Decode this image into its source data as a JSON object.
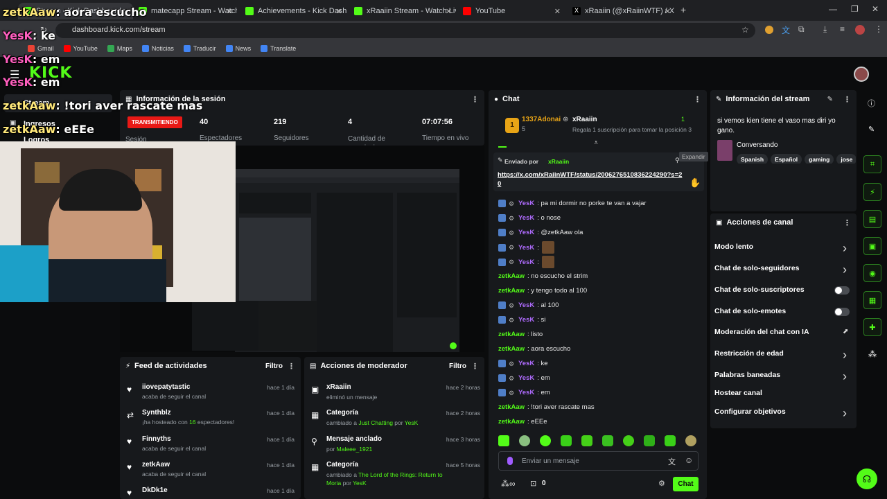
{
  "browser": {
    "tabs": [
      {
        "label": "Stream - Kick Dashboard",
        "color": "#53fc18"
      },
      {
        "label": "matecapp Stream - Watch Live",
        "color": "#53fc18"
      },
      {
        "label": "Achievements - Kick Dashboard",
        "color": "#53fc18"
      },
      {
        "label": "xRaaiin Stream - Watch Live on",
        "color": "#53fc18"
      },
      {
        "label": "YouTube",
        "color": "#ff0000"
      },
      {
        "label": "xRaaiin (@xRaiinWTF) / X",
        "color": "#111111"
      }
    ],
    "url": "dashboard.kick.com/stream",
    "bookmarks": [
      "Gmail",
      "YouTube",
      "Maps",
      "Noticias",
      "Traducir",
      "News",
      "Translate"
    ]
  },
  "overlay_chat": [
    {
      "user": "zetkAaw",
      "text": ": aora escucho",
      "style": "n1"
    },
    {
      "user": "YesK",
      "text": ": ke",
      "style": "n2"
    },
    {
      "user": "YesK",
      "text": ": em",
      "style": "n2"
    },
    {
      "user": "YesK",
      "text": ": em",
      "style": "n2"
    },
    {
      "user": "zetkAaw",
      "text": ": !tori aver rascate mas",
      "style": "n1"
    },
    {
      "user": "zetkAaw",
      "text": ": eEEe",
      "style": "n1"
    }
  ],
  "leftnav": {
    "stream": "Stream",
    "ingresos": "Ingresos",
    "logros": "Logros"
  },
  "session": {
    "title": "Información de la sesión",
    "live_badge": "TRANSMITIENDO",
    "session_label": "Sesión",
    "stats": [
      {
        "value": "40",
        "label": "Espectadores"
      },
      {
        "value": "219",
        "label": "Seguidores"
      },
      {
        "value": "4",
        "label": "Cantidad de suscripciones"
      },
      {
        "value": "07:07:56",
        "label": "Tiempo en vivo"
      }
    ]
  },
  "activity": {
    "title": "Feed de actividades",
    "filter": "Filtro",
    "items": [
      {
        "name": "iiovepatytastic",
        "sub_pre": "acaba de seguir el canal",
        "sub_hl": "",
        "sub_post": "",
        "time": "hace 1 día",
        "icon": "heart-icon"
      },
      {
        "name": "Synthblz",
        "sub_pre": "¡ha hosteado con ",
        "sub_hl": "16",
        "sub_post": " espectadores!",
        "time": "hace 1 día",
        "icon": "host-icon"
      },
      {
        "name": "Finnyths",
        "sub_pre": "acaba de seguir el canal",
        "sub_hl": "",
        "sub_post": "",
        "time": "hace 1 día",
        "icon": "heart-icon"
      },
      {
        "name": "zetkAaw",
        "sub_pre": "acaba de seguir el canal",
        "sub_hl": "",
        "sub_post": "",
        "time": "hace 1 día",
        "icon": "heart-icon"
      },
      {
        "name": "DkDk1e",
        "sub_pre": "",
        "sub_hl": "",
        "sub_post": "",
        "time": "hace 1 día",
        "icon": "heart-icon"
      }
    ]
  },
  "modactions": {
    "title": "Acciones de moderador",
    "filter": "Filtro",
    "items": [
      {
        "name": "xRaaiin",
        "sub_pre": "eliminó un mensaje",
        "hl1": "",
        "mid": "",
        "hl2": "",
        "time": "hace 2 horas"
      },
      {
        "name": "Categoría",
        "sub_pre": "cambiado a ",
        "hl1": "Just Chatting",
        "mid": " por ",
        "hl2": "YesK",
        "time": "hace 2 horas"
      },
      {
        "name": "Mensaje anclado",
        "sub_pre": "por ",
        "hl1": "Maleee_1921",
        "mid": "",
        "hl2": "",
        "time": "hace 3 horas"
      },
      {
        "name": "Categoría",
        "sub_pre": "cambiado a ",
        "hl1": "The Lord of the Rings: Return to Moria",
        "mid": " por ",
        "hl2": "YesK",
        "time": "hace 5 horas"
      }
    ]
  },
  "chat": {
    "title": "Chat",
    "top_user": "1337Adonai",
    "top_rank": "1",
    "top_count": "5",
    "host_user": "xRaaiin",
    "host_count": "1",
    "gift_text": "Regala 1 suscripción para tomar la posición 3",
    "pinned_by_label": "Enviado por",
    "pinned_by": "xRaaiin",
    "expand_tooltip": "Expandir",
    "pinned_link": "https://x.com/xRaiinWTF/status/2006276510836224290?s=20",
    "messages": [
      {
        "user": "YesK",
        "text": ": pa mi dormir no porke te van a vajar",
        "badges": true,
        "emote": false
      },
      {
        "user": "YesK",
        "text": ": o nose",
        "badges": true,
        "emote": false
      },
      {
        "user": "YesK",
        "text": ": @zetkAaw ola",
        "badges": true,
        "emote": false
      },
      {
        "user": "YesK",
        "text": ":",
        "badges": true,
        "emote": true
      },
      {
        "user": "YesK",
        "text": ":",
        "badges": true,
        "emote": true
      },
      {
        "user": "zetkAaw",
        "text": ": no escucho el strim",
        "badges": false,
        "emote": false
      },
      {
        "user": "zetkAaw",
        "text": ": y tengo todo al 100",
        "badges": false,
        "emote": false
      },
      {
        "user": "YesK",
        "text": ": al 100",
        "badges": true,
        "emote": false
      },
      {
        "user": "YesK",
        "text": ": si",
        "badges": true,
        "emote": false
      },
      {
        "user": "zetkAaw",
        "text": ": listo",
        "badges": false,
        "emote": false
      },
      {
        "user": "zetkAaw",
        "text": ": aora escucho",
        "badges": false,
        "emote": false
      },
      {
        "user": "YesK",
        "text": ": ke",
        "badges": true,
        "emote": false
      },
      {
        "user": "YesK",
        "text": ": em",
        "badges": true,
        "emote": false
      },
      {
        "user": "YesK",
        "text": ": em",
        "badges": true,
        "emote": false
      },
      {
        "user": "zetkAaw",
        "text": ": !tori aver rascate mas",
        "badges": false,
        "emote": false
      },
      {
        "user": "zetkAaw",
        "text": ": eEEe",
        "badges": false,
        "emote": false
      }
    ],
    "user_colors": {
      "YesK": "#b06cff",
      "zetkAaw": "#53fc18"
    },
    "input_placeholder": "Enviar un mensaje",
    "points": "0",
    "send_label": "Chat"
  },
  "stream_info": {
    "title": "Información del stream",
    "stream_title": "si vemos kien tiene el vaso mas diri yo gano.",
    "category": "Conversando",
    "tags": [
      "Spanish",
      "Español",
      "gaming",
      "jose"
    ]
  },
  "channel_actions": {
    "title": "Acciones de canal",
    "items": [
      {
        "label": "Modo lento",
        "control": "chevron"
      },
      {
        "label": "Chat de solo-seguidores",
        "control": "chevron"
      },
      {
        "label": "Chat de solo-suscriptores",
        "control": "toggle"
      },
      {
        "label": "Chat de solo-emotes",
        "control": "toggle"
      },
      {
        "label": "Moderación del chat con IA",
        "control": "external"
      },
      {
        "label": "Restricción de edad",
        "control": "chevron"
      },
      {
        "label": "Palabras baneadas",
        "control": "chevron"
      },
      {
        "label": "Hostear canal",
        "control": "none"
      },
      {
        "label": "Configurar objetivos",
        "control": "chevron"
      }
    ]
  },
  "accent": "#53fc18",
  "live_color": "#e91916"
}
